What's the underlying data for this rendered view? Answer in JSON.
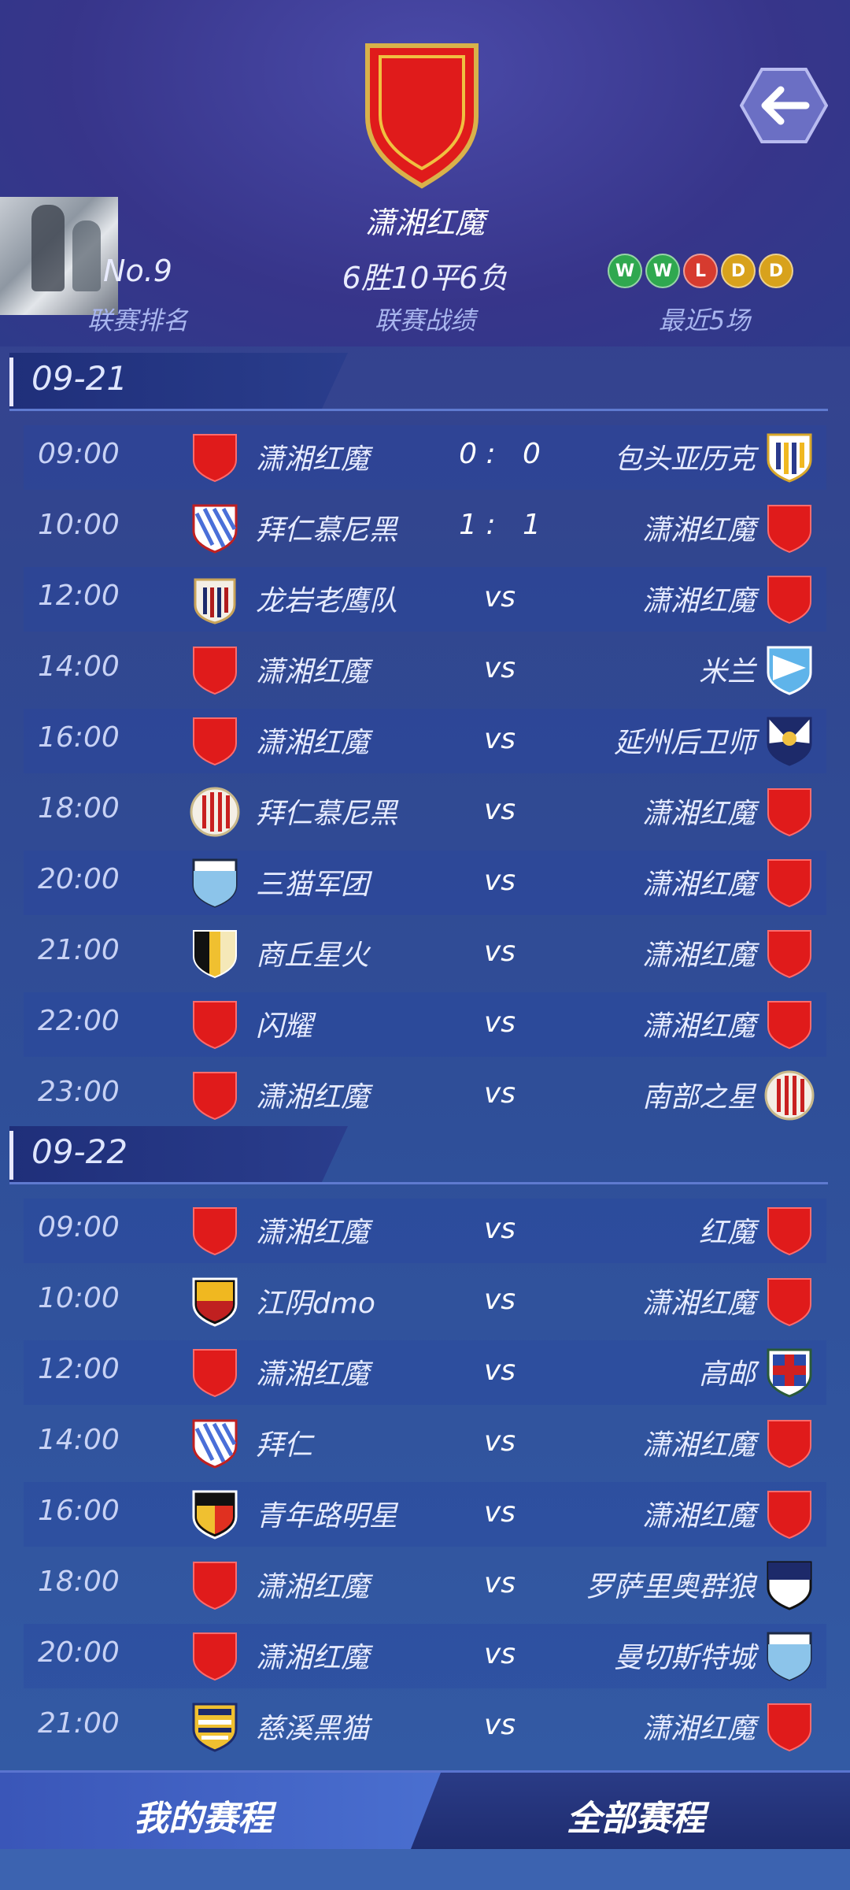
{
  "header": {
    "team_name": "潇湘红魔",
    "rank_value": "No.9",
    "rank_label": "联赛排名",
    "record_value": "6胜10平6负",
    "record_label": "联赛战绩",
    "recent_label": "最近5场",
    "recent_form": [
      "W",
      "W",
      "L",
      "D",
      "D"
    ]
  },
  "colors": {
    "win": "#2fa84f",
    "loss": "#d63b2f",
    "draw": "#d8a21c",
    "red_crest": "#e01b1b"
  },
  "days": [
    {
      "date": "09-21",
      "matches": [
        {
          "time": "09:00",
          "home": "潇湘红魔",
          "home_crest": "red-shield",
          "result": "0 :   0",
          "away": "包头亚历克",
          "away_crest": "yellow-stripe-shield"
        },
        {
          "time": "10:00",
          "home": "拜仁慕尼黑",
          "home_crest": "blue-diagonal-shield",
          "result": "1 :   1",
          "away": "潇湘红魔",
          "away_crest": "red-shield"
        },
        {
          "time": "12:00",
          "home": "龙岩老鹰队",
          "home_crest": "navy-stripe-badge",
          "result": "vs",
          "away": "潇湘红魔",
          "away_crest": "red-shield"
        },
        {
          "time": "14:00",
          "home": "潇湘红魔",
          "home_crest": "red-shield",
          "result": "vs",
          "away": "米兰",
          "away_crest": "lightblue-pennant-shield"
        },
        {
          "time": "16:00",
          "home": "潇湘红魔",
          "home_crest": "red-shield",
          "result": "vs",
          "away": "延州后卫师",
          "away_crest": "navy-cross-shield"
        },
        {
          "time": "18:00",
          "home": "拜仁慕尼黑",
          "home_crest": "red-stripe-circle",
          "result": "vs",
          "away": "潇湘红魔",
          "away_crest": "red-shield"
        },
        {
          "time": "20:00",
          "home": "三猫军团",
          "home_crest": "skyblue-shield",
          "result": "vs",
          "away": "潇湘红魔",
          "away_crest": "red-shield"
        },
        {
          "time": "21:00",
          "home": "商丘星火",
          "home_crest": "black-yellow-shield",
          "result": "vs",
          "away": "潇湘红魔",
          "away_crest": "red-shield"
        },
        {
          "time": "22:00",
          "home": "闪耀",
          "home_crest": "red-shield",
          "result": "vs",
          "away": "潇湘红魔",
          "away_crest": "red-shield"
        },
        {
          "time": "23:00",
          "home": "潇湘红魔",
          "home_crest": "red-shield",
          "result": "vs",
          "away": "南部之星",
          "away_crest": "red-stripe-circle"
        }
      ]
    },
    {
      "date": "09-22",
      "matches": [
        {
          "time": "09:00",
          "home": "潇湘红魔",
          "home_crest": "red-shield",
          "result": "vs",
          "away": "红魔",
          "away_crest": "red-shield"
        },
        {
          "time": "10:00",
          "home": "江阴dmo",
          "home_crest": "yellow-black-shield",
          "result": "vs",
          "away": "潇湘红魔",
          "away_crest": "red-shield"
        },
        {
          "time": "12:00",
          "home": "潇湘红魔",
          "home_crest": "red-shield",
          "result": "vs",
          "away": "高邮",
          "away_crest": "red-cross-shield"
        },
        {
          "time": "14:00",
          "home": "拜仁",
          "home_crest": "blue-diagonal-shield",
          "result": "vs",
          "away": "潇湘红魔",
          "away_crest": "red-shield"
        },
        {
          "time": "16:00",
          "home": "青年路明星",
          "home_crest": "black-orange-shield",
          "result": "vs",
          "away": "潇湘红魔",
          "away_crest": "red-shield"
        },
        {
          "time": "18:00",
          "home": "潇湘红魔",
          "home_crest": "red-shield",
          "result": "vs",
          "away": "罗萨里奥群狼",
          "away_crest": "navy-white-shield"
        },
        {
          "time": "20:00",
          "home": "潇湘红魔",
          "home_crest": "red-shield",
          "result": "vs",
          "away": "曼切斯特城",
          "away_crest": "skyblue-shield"
        },
        {
          "time": "21:00",
          "home": "慈溪黑猫",
          "home_crest": "navy-yellow-stripe-shield",
          "result": "vs",
          "away": "潇湘红魔",
          "away_crest": "red-shield"
        }
      ]
    }
  ],
  "nav": {
    "my_schedule": "我的赛程",
    "all_schedule": "全部赛程"
  }
}
